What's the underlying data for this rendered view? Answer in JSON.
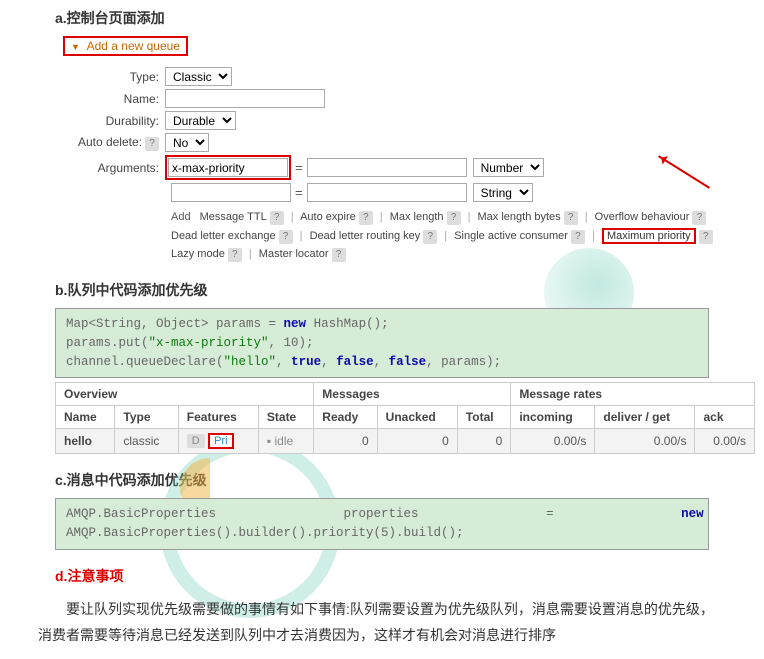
{
  "sections": {
    "a": "a.控制台页面添加",
    "b": "b.队列中代码添加优先级",
    "c": "c.消息中代码添加优先级",
    "d": "d.注意事项"
  },
  "form": {
    "header": "Add a new queue",
    "type_label": "Type:",
    "type_value": "Classic",
    "name_label": "Name:",
    "name_value": "",
    "durability_label": "Durability:",
    "durability_value": "Durable",
    "autodelete_label": "Auto delete:",
    "autodelete_value": "No",
    "arguments_label": "Arguments:",
    "arguments_key": "x-max-priority",
    "arguments_val1": "",
    "arguments_type1": "Number",
    "arguments_key2": "",
    "arguments_val2": "",
    "arguments_type2": "String",
    "add_label": "Add",
    "hints": {
      "msg_ttl": "Message TTL",
      "auto_expire": "Auto expire",
      "max_len": "Max length",
      "max_len_bytes": "Max length bytes",
      "overflow": "Overflow behaviour",
      "dlx": "Dead letter exchange",
      "dlrk": "Dead letter routing key",
      "sac": "Single active consumer",
      "max_prio": "Maximum priority",
      "lazy": "Lazy mode",
      "master": "Master locator"
    }
  },
  "code_b": {
    "l1a": "Map<String, Object> params = ",
    "l1b": "new",
    "l1c": " HashMap();",
    "l2a": "params.put(",
    "l2b": "\"x-max-priority\"",
    "l2c": ", 10);",
    "l3a": "channel.queueDeclare(",
    "l3b": "\"hello\"",
    "l3c": ", ",
    "l3d": "true",
    "l3e": ", ",
    "l3f": "false",
    "l3g": ", ",
    "l3h": "false",
    "l3i": ", params);"
  },
  "qtable": {
    "g_overview": "Overview",
    "g_messages": "Messages",
    "g_rates": "Message rates",
    "h_name": "Name",
    "h_type": "Type",
    "h_features": "Features",
    "h_state": "State",
    "h_ready": "Ready",
    "h_unacked": "Unacked",
    "h_total": "Total",
    "h_incoming": "incoming",
    "h_deliver": "deliver / get",
    "h_ack": "ack",
    "row": {
      "name": "hello",
      "type": "classic",
      "feat_d": "D",
      "feat_pri": "Pri",
      "state": "idle",
      "ready": "0",
      "unacked": "0",
      "total": "0",
      "incoming": "0.00/s",
      "deliver": "0.00/s",
      "ack": "0.00/s"
    }
  },
  "code_c": {
    "l1a": "AMQP.BasicProperties                 properties                 =                 ",
    "l1b": "new",
    "l2": "AMQP.BasicProperties().builder().priority(5).build();"
  },
  "paragraph": "要让队列实现优先级需要做的事情有如下事情:队列需要设置为优先级队列，消息需要设置消息的优先级，消费者需要等待消息已经发送到队列中才去消费因为，这样才有机会对消息进行排序"
}
